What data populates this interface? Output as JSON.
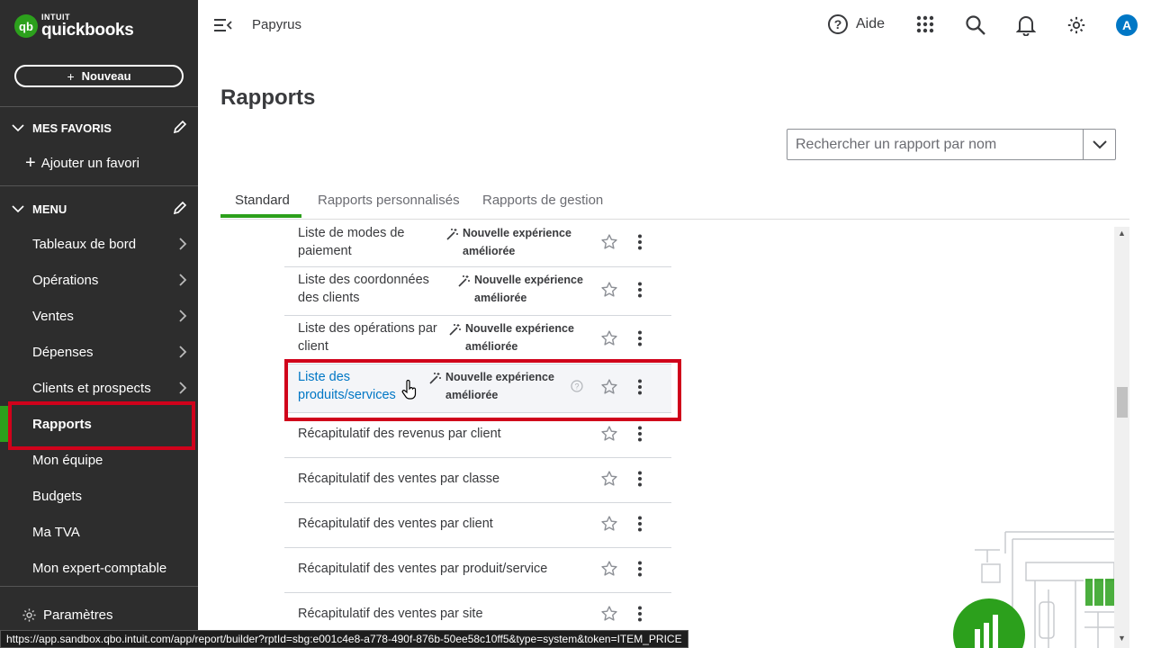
{
  "brand": {
    "top": "INTUIT",
    "main": "quickbooks",
    "badge": "qb"
  },
  "sidebar": {
    "new_label": "Nouveau",
    "favorites_heading": "MES FAVORIS",
    "add_favorite": "Ajouter un favori",
    "menu_heading": "MENU",
    "items": [
      {
        "label": "Tableaux de bord",
        "has_arrow": true
      },
      {
        "label": "Opérations",
        "has_arrow": true
      },
      {
        "label": "Ventes",
        "has_arrow": true
      },
      {
        "label": "Dépenses",
        "has_arrow": true
      },
      {
        "label": "Clients et prospects",
        "has_arrow": true
      },
      {
        "label": "Rapports",
        "has_arrow": false,
        "active": true
      },
      {
        "label": "Mon équipe",
        "has_arrow": false
      },
      {
        "label": "Budgets",
        "has_arrow": false
      },
      {
        "label": "Ma TVA",
        "has_arrow": false
      },
      {
        "label": "Mon expert-comptable",
        "has_arrow": false
      }
    ],
    "settings": "Paramètres"
  },
  "topbar": {
    "company": "Papyrus",
    "help": "Aide",
    "avatar": "A"
  },
  "main": {
    "title": "Rapports",
    "search_placeholder": "Rechercher un rapport par nom",
    "tabs": [
      "Standard",
      "Rapports personnalisés",
      "Rapports de gestion"
    ],
    "badge_text": "Nouvelle expérience améliorée",
    "rows": [
      {
        "name": "Liste de modes de paiement",
        "badge": true
      },
      {
        "name": "Liste des coordonnées des clients",
        "badge": true
      },
      {
        "name": "Liste des opérations par client",
        "badge": true
      },
      {
        "name": "Liste des produits/services",
        "badge": true,
        "highlighted": true,
        "info": true
      },
      {
        "name": "Récapitulatif des revenus par client",
        "badge": false
      },
      {
        "name": "Récapitulatif des ventes par classe",
        "badge": false
      },
      {
        "name": "Récapitulatif des ventes par client",
        "badge": false
      },
      {
        "name": "Récapitulatif des ventes par produit/service",
        "badge": false
      },
      {
        "name": "Récapitulatif des ventes par site",
        "badge": false
      }
    ]
  },
  "status_url": "https://app.sandbox.qbo.intuit.com/app/report/builder?rptId=sbg:e001c4e8-a778-490f-876b-50ee58c10ff5&type=system&token=ITEM_PRICE",
  "colors": {
    "brand_green": "#2ca01c",
    "sidebar_bg": "#2d2d2d",
    "highlight_red": "#d0021b",
    "link_blue": "#0077c5"
  }
}
